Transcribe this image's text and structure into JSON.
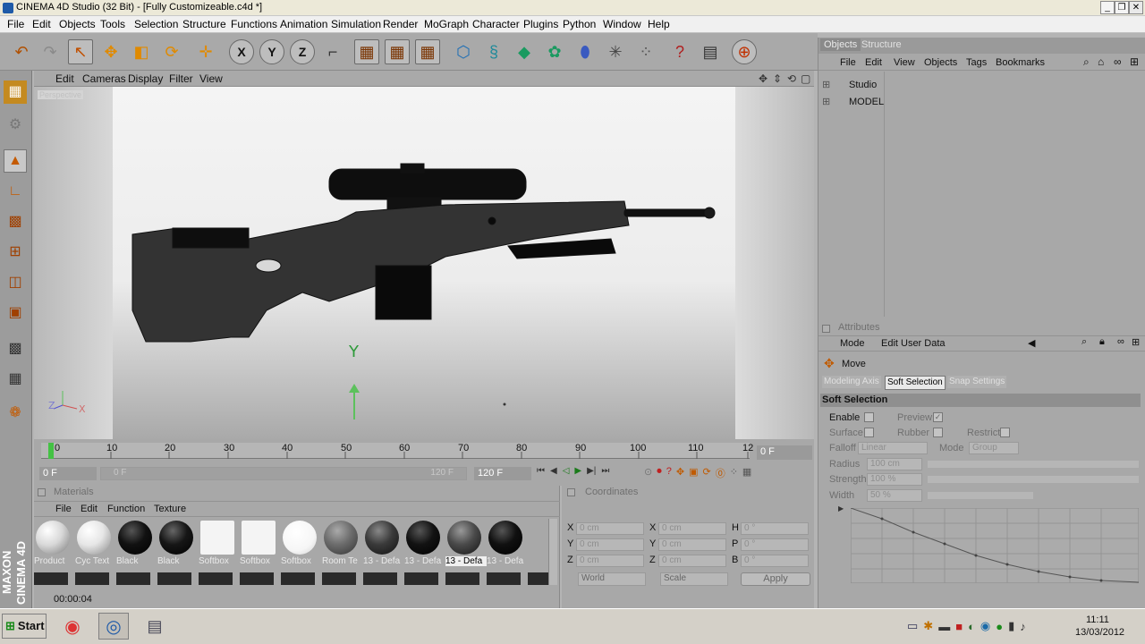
{
  "window": {
    "title": "CINEMA 4D Studio (32 Bit) - [Fully Customizeable.c4d *]"
  },
  "menubar": [
    "File",
    "Edit",
    "Objects",
    "Tools",
    "Selection",
    "Structure",
    "Functions",
    "Animation",
    "Simulation",
    "Render",
    "MoGraph",
    "Character",
    "Plugins",
    "Python",
    "Window",
    "Help"
  ],
  "toolbar": {
    "axis_x": "X",
    "axis_y": "Y",
    "axis_z": "Z"
  },
  "viewport": {
    "menu": [
      "Edit",
      "Cameras",
      "Display",
      "Filter",
      "View"
    ],
    "label": "Perspective",
    "axis_y": "Y",
    "axis_z": "Z",
    "axis_x": "X"
  },
  "timeline": {
    "ticks": [
      "0",
      "10",
      "20",
      "30",
      "40",
      "50",
      "60",
      "70",
      "80",
      "90",
      "100",
      "110",
      "12"
    ],
    "current_frame": "0 F",
    "start_field": "0 F",
    "range_start": "0 F",
    "range_end": "120 F",
    "end_field": "120 F"
  },
  "materials": {
    "title": "Materials",
    "menu": [
      "File",
      "Edit",
      "Function",
      "Texture"
    ],
    "items": [
      {
        "name": "Product",
        "color": "#d8d8d8"
      },
      {
        "name": "Cyc Text",
        "color": "#e6e6e6"
      },
      {
        "name": "Black",
        "color": "#111111"
      },
      {
        "name": "Black",
        "color": "#161616"
      },
      {
        "name": "Softbox",
        "color": "#f4f4f4"
      },
      {
        "name": "Softbox",
        "color": "#f4f4f4"
      },
      {
        "name": "Softbox",
        "color": "#f6f6f6"
      },
      {
        "name": "Room Te",
        "color": "#6c6c6c"
      },
      {
        "name": "13 - Defa",
        "color": "#3a3a3a"
      },
      {
        "name": "13 - Defa",
        "color": "#121212"
      },
      {
        "name": "13 - Defa",
        "color": "#4a4a4a"
      },
      {
        "name": "13 - Defa",
        "color": "#101010"
      }
    ],
    "status_time": "00:00:04"
  },
  "coordinates": {
    "title": "Coordinates",
    "rows": [
      {
        "a": "X",
        "av": "0 cm",
        "b": "X",
        "bv": "0 cm",
        "c": "H",
        "cv": "0 °"
      },
      {
        "a": "Y",
        "av": "0 cm",
        "b": "Y",
        "bv": "0 cm",
        "c": "P",
        "cv": "0 °"
      },
      {
        "a": "Z",
        "av": "0 cm",
        "b": "Z",
        "bv": "0 cm",
        "c": "B",
        "cv": "0 °"
      }
    ],
    "mode_world": "World",
    "mode_scale": "Scale",
    "apply": "Apply"
  },
  "objects": {
    "tabs": [
      "Objects",
      "Structure"
    ],
    "menu": [
      "File",
      "Edit",
      "View",
      "Objects",
      "Tags",
      "Bookmarks"
    ],
    "items": [
      "Studio",
      "MODEL"
    ]
  },
  "attributes": {
    "title": "Attributes",
    "menu": [
      "Mode",
      "Edit",
      "User Data"
    ],
    "tool": "Move",
    "tabs": [
      "Modeling Axis",
      "Soft Selection",
      "Snap Settings"
    ],
    "section": "Soft Selection",
    "enable": "Enable",
    "preview": "Preview",
    "surface": "Surface",
    "rubber": "Rubber",
    "restrict": "Restrict",
    "falloff": "Falloff",
    "falloff_value": "Linear",
    "mode": "Mode",
    "mode_value": "Group",
    "radius": "Radius",
    "radius_value": "100 cm",
    "strength": "Strength",
    "strength_value": "100 %",
    "width": "Width",
    "width_value": "50 %"
  },
  "taskbar": {
    "start": "Start",
    "time": "11:11",
    "date": "13/03/2012"
  }
}
